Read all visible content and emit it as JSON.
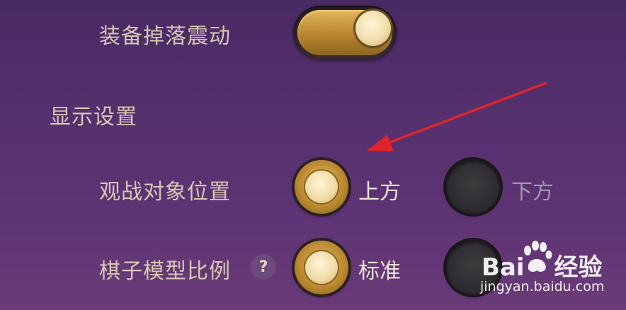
{
  "settings": {
    "equip_drop_vibration": {
      "label": "装备掉落震动",
      "enabled": true
    },
    "display_section": {
      "title": "显示设置"
    },
    "spectate_position": {
      "label": "观战对象位置",
      "options": [
        "上方",
        "下方"
      ],
      "selected": "上方"
    },
    "piece_model_scale": {
      "label": "棋子模型比例",
      "help": "?",
      "options": [
        "标准"
      ],
      "selected": "标准"
    }
  },
  "watermark": {
    "brand_left": "Bai",
    "brand_right": "经验",
    "url": "jingyan.baidu.com"
  },
  "colors": {
    "arrow": "#e0242a",
    "accent_gold": "#c99a42",
    "background": "#54306d"
  }
}
